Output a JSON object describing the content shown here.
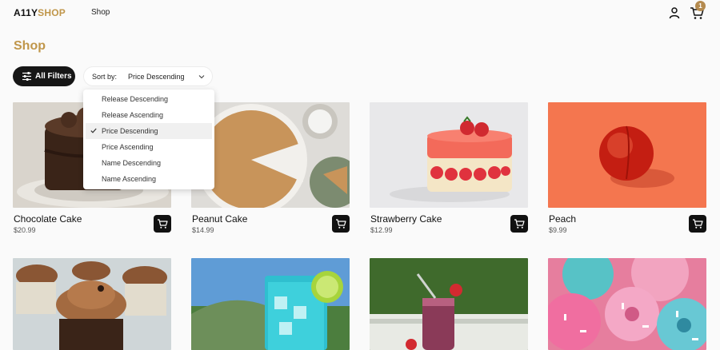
{
  "header": {
    "logo_main": "A11Y",
    "logo_accent": "SHOP",
    "nav_shop": "Shop",
    "cart_count": "1"
  },
  "page": {
    "title": "Shop"
  },
  "filters": {
    "label": "All Filters"
  },
  "sort": {
    "label": "Sort by:",
    "value": "Price Descending",
    "options": [
      "Release Descending",
      "Release Ascending",
      "Price Descending",
      "Price Ascending",
      "Name Descending",
      "Name Ascending"
    ],
    "selected_index": 2
  },
  "products": [
    {
      "name": "Chocolate Cake",
      "price": "$20.99"
    },
    {
      "name": "Peanut Cake",
      "price": "$14.99"
    },
    {
      "name": "Strawberry Cake",
      "price": "$12.99"
    },
    {
      "name": "Peach",
      "price": "$9.99"
    }
  ],
  "colors": {
    "accent": "#c0964a",
    "button_dark": "#161616",
    "badge": "#b58b4f"
  }
}
